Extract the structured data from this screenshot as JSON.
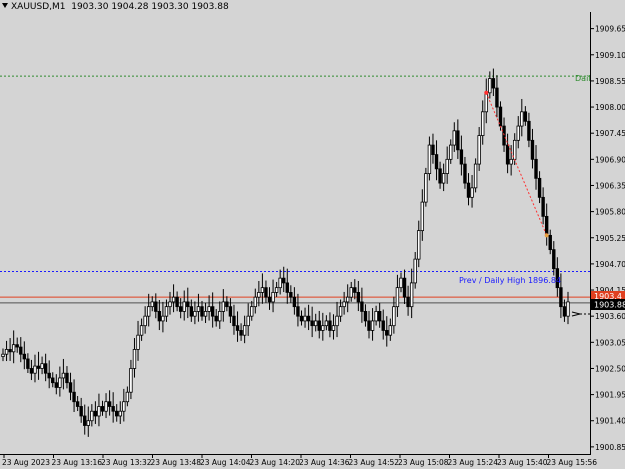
{
  "header": {
    "symbol": "XAUUSD,M1",
    "ohlc": "1903.30 1904.28 1903.30 1903.88"
  },
  "colors": {
    "background": "#d4d4d4",
    "candle": "#000000",
    "daily_high_line": "#2e8b2e",
    "prev_daily_high_line": "#1a1aff",
    "ask_line": "#e04020",
    "bid_line": "#505050",
    "price_badge": "#000000",
    "trend_marker": "#ff3030"
  },
  "labels": {
    "daily_high": "Dail",
    "prev_daily_high": "Prev / Daily High 1896.84",
    "current_price": "1903.88",
    "ask_price": "1903.4"
  },
  "chart_data": {
    "type": "candlestick",
    "y_range": [
      1900.7,
      1910.0
    ],
    "y_ticks": [
      "1909.65",
      "1909.10",
      "1908.55",
      "1908.00",
      "1907.45",
      "1906.90",
      "1906.35",
      "1905.80",
      "1905.25",
      "1904.70",
      "1904.15",
      "1903.60",
      "1903.05",
      "1902.50",
      "1901.95",
      "1901.40",
      "1900.85"
    ],
    "x_ticks": [
      "23 Aug 2023",
      "23 Aug 13:16",
      "23 Aug 13:32",
      "23 Aug 13:48",
      "23 Aug 14:04",
      "23 Aug 14:20",
      "23 Aug 14:36",
      "23 Aug 14:52",
      "23 Aug 15:08",
      "23 Aug 15:24",
      "23 Aug 15:40",
      "23 Aug 15:56"
    ],
    "levels": {
      "daily_high": 1908.65,
      "prev_daily_high": 1904.54,
      "ask": 1904.0,
      "bid": 1903.88
    },
    "close": [
      1902.8,
      1902.9,
      1902.85,
      1903.0,
      1902.95,
      1902.8,
      1902.7,
      1902.5,
      1902.4,
      1902.55,
      1902.5,
      1902.6,
      1902.4,
      1902.3,
      1902.2,
      1902.1,
      1902.3,
      1902.4,
      1902.2,
      1902.0,
      1901.8,
      1901.7,
      1901.5,
      1901.3,
      1901.4,
      1901.6,
      1901.5,
      1901.7,
      1901.6,
      1901.8,
      1901.7,
      1901.6,
      1901.5,
      1901.6,
      1901.8,
      1902.0,
      1902.5,
      1902.9,
      1903.2,
      1903.4,
      1903.6,
      1903.8,
      1903.9,
      1903.7,
      1903.5,
      1903.6,
      1903.8,
      1903.9,
      1904.0,
      1903.8,
      1903.7,
      1903.9,
      1903.8,
      1903.6,
      1903.7,
      1903.8,
      1903.6,
      1903.7,
      1903.8,
      1903.6,
      1903.5,
      1903.7,
      1903.9,
      1903.8,
      1903.6,
      1903.4,
      1903.3,
      1903.2,
      1903.4,
      1903.6,
      1903.8,
      1904.0,
      1904.1,
      1904.2,
      1904.0,
      1903.9,
      1904.1,
      1904.2,
      1904.4,
      1904.3,
      1904.1,
      1904.0,
      1903.8,
      1903.6,
      1903.5,
      1903.6,
      1903.5,
      1903.4,
      1903.5,
      1903.3,
      1903.4,
      1903.5,
      1903.3,
      1903.4,
      1903.6,
      1903.8,
      1903.9,
      1904.0,
      1904.2,
      1904.1,
      1903.9,
      1903.7,
      1903.5,
      1903.3,
      1903.5,
      1903.7,
      1903.5,
      1903.3,
      1903.2,
      1903.4,
      1903.8,
      1904.2,
      1904.4,
      1904.0,
      1903.8,
      1904.3,
      1904.8,
      1905.4,
      1906.0,
      1906.6,
      1907.2,
      1907.0,
      1906.7,
      1906.4,
      1906.6,
      1906.9,
      1907.2,
      1907.5,
      1907.1,
      1906.8,
      1906.4,
      1906.1,
      1906.3,
      1906.8,
      1907.4,
      1907.9,
      1908.3,
      1908.6,
      1908.4,
      1908.0,
      1907.6,
      1907.2,
      1906.8,
      1906.9,
      1907.3,
      1907.6,
      1907.9,
      1907.7,
      1907.3,
      1906.9,
      1906.5,
      1906.1,
      1905.7,
      1905.3,
      1905.0,
      1904.6,
      1904.2,
      1903.8,
      1903.6,
      1903.9
    ]
  }
}
